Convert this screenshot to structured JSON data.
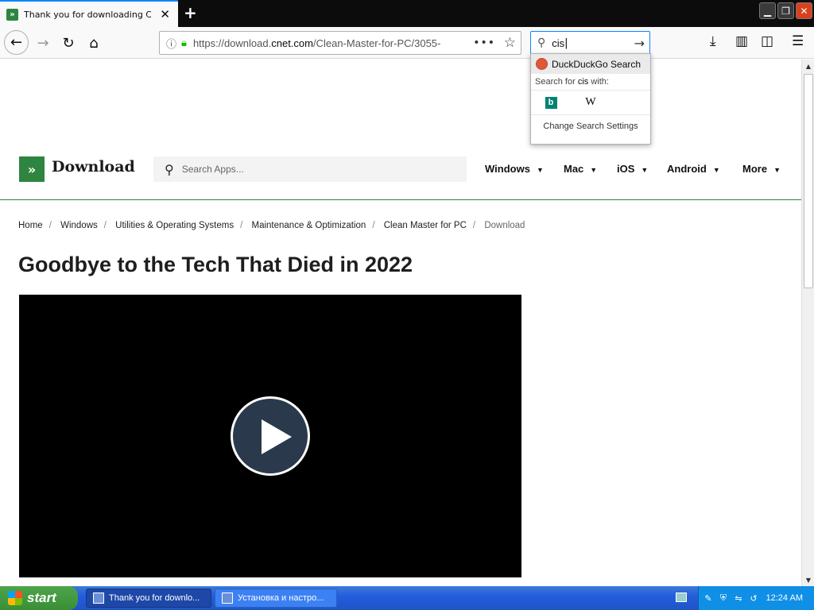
{
  "browser": {
    "tab_title": "Thank you for downloading Clean Master",
    "url_prefix": "https://download.",
    "url_domain": "cnet.com",
    "url_path": "/Clean-Master-for-PC/3055-",
    "search_value": "cis"
  },
  "search_dropdown": {
    "engine_name": "DuckDuckGo Search",
    "search_for_prefix": "Search for",
    "search_term": "cis",
    "search_for_suffix": "with:",
    "engines": [
      "bing-icon",
      "wikipedia-icon"
    ],
    "change_settings": "Change Search Settings"
  },
  "site": {
    "logo_text": "Download",
    "search_placeholder": "Search Apps...",
    "menu": [
      "Windows",
      "Mac",
      "iOS",
      "Android",
      "More"
    ],
    "breadcrumbs": [
      "Home",
      "Windows",
      "Utilities & Operating Systems",
      "Maintenance & Optimization",
      "Clean Master for PC"
    ],
    "breadcrumb_current": "Download",
    "headline": "Goodbye to the Tech That Died in 2022"
  },
  "taskbar": {
    "start_label": "start",
    "tasks": [
      "Thank you for downlo...",
      "Установка и настро..."
    ],
    "clock": "12:24 AM"
  },
  "colors": {
    "brand_green": "#2e8540",
    "taskbar_blue": "#245edc"
  }
}
